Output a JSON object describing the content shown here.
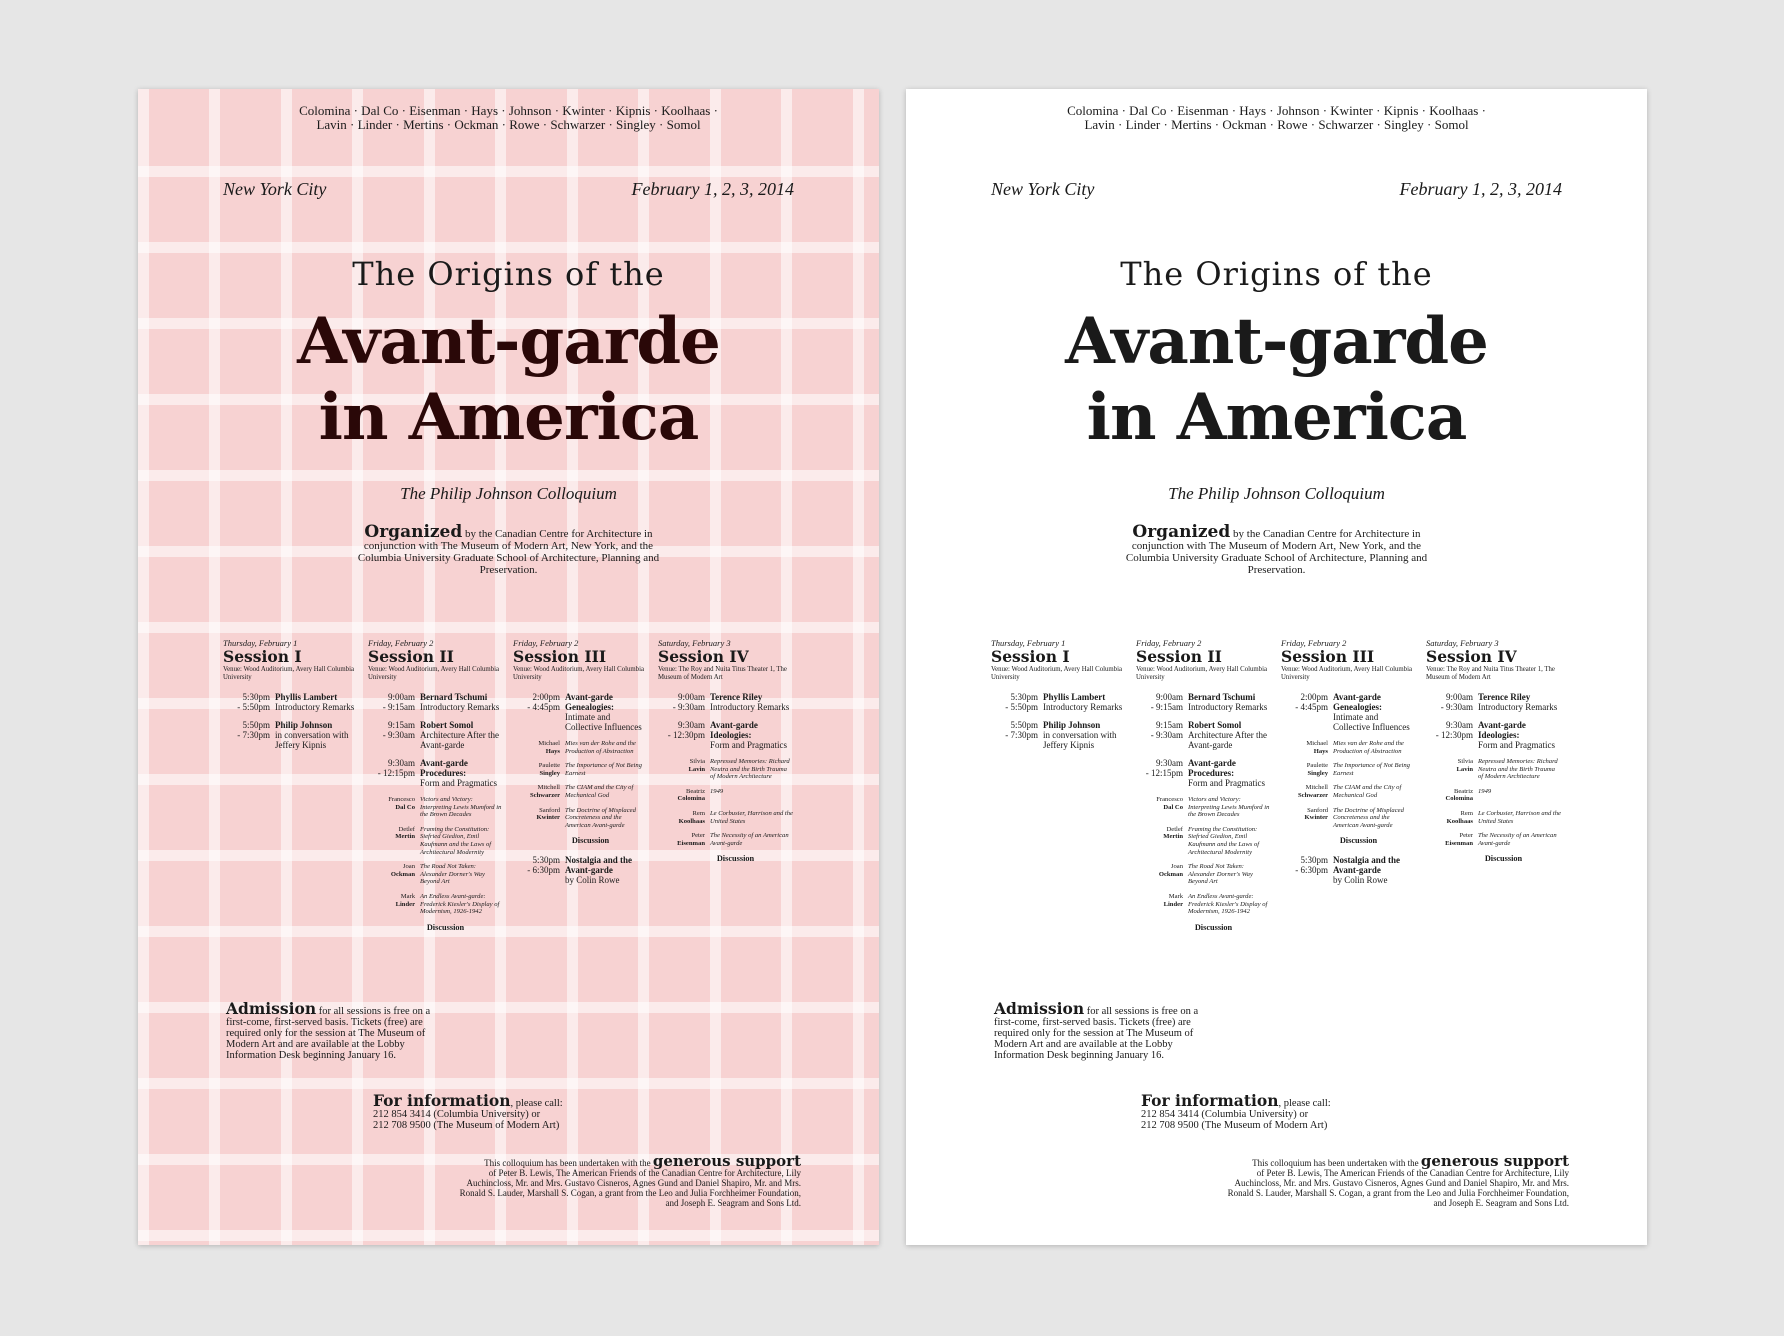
{
  "poster": {
    "names_line1": "Colomina · Dal Co · Eisenman · Hays · Johnson · Kwinter · Kipnis · Koolhaas ·",
    "names_line2": "Lavin · Linder · Mertins · Ockman · Rowe · Schwarzer · Singley · Somol",
    "city": "New York City",
    "date": "February 1, 2, 3, 2014",
    "pre_title": "The Origins of the",
    "title_line1": "Avant-garde",
    "title_line2": "in America",
    "subtitle": "The Philip Johnson Colloquium",
    "organized_lead": "Organized",
    "organized_text": " by the Canadian Centre for Architecture in conjunction with The Museum of Modern Art, New York, and the Columbia University Graduate School of Architecture, Planning and Preservation.",
    "sessions": [
      {
        "day": "Thursday, February 1",
        "title": "Session I",
        "venue": "Venue: Wood Auditorium, Avery Hall Columbia University",
        "items": [
          {
            "time": "5:30pm\n- 5:50pm",
            "name": "Phyllis Lambert",
            "desc": "Introductory Remarks"
          },
          {
            "time": "5:50pm\n- 7:30pm",
            "name": "Philip Johnson",
            "desc": "in conversation with Jeffery Kipnis"
          }
        ]
      },
      {
        "day": "Friday, February 2",
        "title": "Session II",
        "venue": "Venue: Wood Auditorium, Avery Hall Columbia University",
        "items": [
          {
            "time": "9:00am\n- 9:15am",
            "name": "Bernard Tschumi",
            "desc": "Introductory Remarks"
          },
          {
            "time": "9:15am\n- 9:30am",
            "name": "Robert Somol",
            "desc": "Architecture After the Avant-garde"
          },
          {
            "time": "9:30am\n- 12:15pm",
            "name": "Avant-garde Procedures:",
            "desc": "Form and Pragmatics"
          }
        ],
        "talks": [
          {
            "first": "Francesco",
            "last": "Dal Co",
            "text": "Victors and Victory: Interpreting Lewis Mumford in the Brown Decades"
          },
          {
            "first": "Detlef",
            "last": "Mertin",
            "text": "Framing the Constitution: Siefried Giedion, Emil Kaufmann and the Laws of Architectural Modernity"
          },
          {
            "first": "Joan",
            "last": "Ockman",
            "text": "The Road Not Taken: Alexander Dorner's Way Beyond Art"
          },
          {
            "first": "Mark",
            "last": "Linder",
            "text": "An Endless Avant-garde: Frederick Kiesler's Display of Modernism, 1926-1942"
          }
        ],
        "discussion": "Discussion"
      },
      {
        "day": "Friday, February 2",
        "title": "Session III",
        "venue": "Venue: Wood Auditorium, Avery Hall Columbia University",
        "items": [
          {
            "time": "2:00pm\n- 4:45pm",
            "name": "Avant-garde Genealogies:",
            "desc": "Intimate and Collective Influences"
          }
        ],
        "talks": [
          {
            "first": "Michael",
            "last": "Hays",
            "text": "Mies van der Rohe and the Production of Abstraction"
          },
          {
            "first": "Paulette",
            "last": "Singley",
            "text": "The Importance of Not Being Earnest"
          },
          {
            "first": "Mitchell",
            "last": "Schwarzer",
            "text": "The CIAM and the City of Mechanical God"
          },
          {
            "first": "Sanford",
            "last": "Kwinter",
            "text": "The Doctrine of Misplaced Concreteness and the American Avant-garde"
          }
        ],
        "discussion": "Discussion",
        "after": {
          "time": "5:30pm\n- 6:30pm",
          "name": "Nostalgia and the Avant-garde",
          "desc": "by Colin Rowe"
        }
      },
      {
        "day": "Saturday, February 3",
        "title": "Session IV",
        "venue": "Venue: The Roy and Nuita Titus Theater 1, The Museum of Modern Art",
        "items": [
          {
            "time": "9:00am\n- 9:30am",
            "name": "Terence Riley",
            "desc": "Introductory Remarks"
          },
          {
            "time": "9:30am\n- 12:30pm",
            "name": "Avant-garde Ideologies:",
            "desc": "Form and Pragmatics"
          }
        ],
        "talks": [
          {
            "first": "Silvia",
            "last": "Lavin",
            "text": "Repressed Memories: Richard Neutra and the Birth Trauma of Modern Architecture"
          },
          {
            "first": "Beatriz",
            "last": "Colomina",
            "text": "1949"
          },
          {
            "first": "Rem",
            "last": "Koolhaas",
            "text": "Le Corbusier, Harrison and the United States"
          },
          {
            "first": "Peter",
            "last": "Eisenman",
            "text": "The Necessity of an American Avant-garde"
          }
        ],
        "discussion": "Discussion"
      }
    ],
    "admission_lead": "Admission",
    "admission_text": " for all sessions is free on a first-come, first-served basis. Tickets (free) are required only for the session at The Museum of Modern Art and are available at the Lobby Information Desk beginning January 16.",
    "info_lead": "For information",
    "info_text": ", please call:",
    "info_phone1": "212 854 3414  (Columbia University) or",
    "info_phone2": "212 708 9500 (The Museum of Modern Art)",
    "support_pre": "This colloquium has been undertaken with the ",
    "support_lead": "generous support",
    "support_text": "of Peter B. Lewis, The American Friends of the Canadian Centre for Architecture, Lily Auchincloss, Mr. and Mrs. Gustavo Cisneros, Agnes Gund and Daniel Shapiro, Mr. and Mrs. Ronald S. Lauder, Marshall S. Cogan, a grant from the Leo and Julia Forchheimer Foundation, and Joseph E. Seagram and Sons Ltd."
  },
  "colors": {
    "background": "#e6e6e6",
    "left_poster_bg": "#f7d2d2",
    "right_poster_bg": "#ffffff",
    "text": "#1a1a1a"
  }
}
